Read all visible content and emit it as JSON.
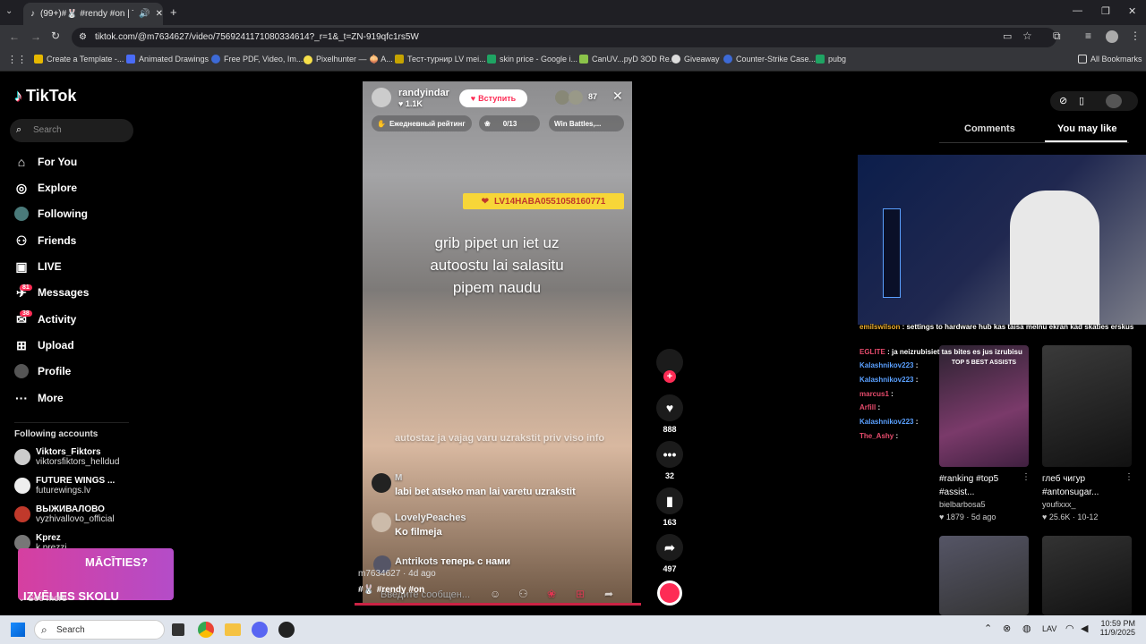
{
  "browser": {
    "tab_title": "(99+)#🐰 #rendy #on | Tik",
    "url": "tiktok.com/@m7634627/video/7569241171080334614?_r=1&_t=ZN-919qfc1rs5W",
    "bookmarks": [
      "Create a Template -...",
      "Animated Drawings",
      "Free PDF, Video, Im...",
      "Pixelhunter — 🧅 A...",
      "Тест-турнир LV mei...",
      "skin price - Google i...",
      "CanUV...pyD 3OD Re...",
      "Giveaway",
      "Counter-Strike Case...",
      "pubg"
    ],
    "all_bookmarks": "All Bookmarks"
  },
  "tiktok": {
    "logo": "TikTok",
    "search_placeholder": "Search",
    "nav": [
      "For You",
      "Explore",
      "Following",
      "Friends",
      "LIVE",
      "Messages",
      "Activity",
      "Upload",
      "Profile",
      "More"
    ],
    "messages_badge": "81",
    "activity_badge": "38",
    "following_heading": "Following accounts",
    "accounts": [
      {
        "name": "Viktors_Fiktors",
        "handle": "viktorsfiktors_helldud"
      },
      {
        "name": "FUTURE WINGS ...",
        "handle": "futurewings.lv"
      },
      {
        "name": "ВЫЖИВАЛОВО",
        "handle": "vyzhivallovo_official"
      },
      {
        "name": "Kprez",
        "handle": "k.prezzi"
      }
    ],
    "see_more": "See more",
    "promo_line1": "MĀCĪTIES?",
    "promo_line2": "IZVĒLIES SKOLU"
  },
  "video": {
    "streamer": "randyindar",
    "streamer_likes": "1.1K",
    "join_button": "Вступить",
    "viewers": "87",
    "daily_rating": "Ежедневный рейтинг",
    "progress": "0/13",
    "win_battles": "Win Battles,...",
    "code_banner": "LV14HABA0551058160771",
    "caption": "grib pipet un iet uz autoostu lai salasitu pipem naudu",
    "comments": [
      {
        "user": "",
        "text": "autostaz ja vajag varu uzrakstit priv viso info"
      },
      {
        "user": "M",
        "text": "labi bet atseko man lai varetu uzrakstit"
      },
      {
        "user": "LovelyPeaches",
        "text": "Ko filmeja"
      },
      {
        "user": "Antrikots",
        "text": "теперь с нами"
      }
    ],
    "author": "m7634627",
    "age": "4d ago",
    "hashtags": "#🐰 #rendy #on",
    "message_placeholder": "Введите сообщен..."
  },
  "actions": {
    "likes": "888",
    "comments": "32",
    "saves": "163",
    "shares": "497"
  },
  "right": {
    "tab_comments": "Comments",
    "tab_you_may_like": "You may like",
    "chat": [
      {
        "user": "emilswilson",
        "text": ": settings to hardware hub kas taisa melnu ekran kad skaties erskus",
        "color": "#f0b030"
      },
      {
        "user": "EGLITE",
        "text": ": ja neizrubisiet tas bites es jus izrubisu",
        "color": "#e64b6c"
      },
      {
        "user": "Kalashnikov223",
        "text": ":",
        "color": "#5aa0ff"
      },
      {
        "user": "Kalashnikov223",
        "text": ":",
        "color": "#5aa0ff"
      },
      {
        "user": "marcus1",
        "text": ":",
        "color": "#e64b6c"
      },
      {
        "user": "Arfill",
        "text": ":",
        "color": "#e64b6c"
      },
      {
        "user": "Kalashnikov223",
        "text": ":",
        "color": "#5aa0ff"
      },
      {
        "user": "The_Ashy",
        "text": ":",
        "color": "#e64b6c"
      }
    ],
    "cards": [
      {
        "title": "#ranking #top5 #assist...",
        "author": "bielbarbosa5",
        "stats": "1879 · 5d ago",
        "overlay": "TOP 5 BEST ASSISTS"
      },
      {
        "title": "глеб чигур #antonsugar...",
        "author": "youfixxx_",
        "stats": "25.6K · 10-12"
      }
    ]
  },
  "taskbar": {
    "search": "Search",
    "lang": "LAV",
    "time": "10:59 PM",
    "date": "11/9/2025"
  }
}
